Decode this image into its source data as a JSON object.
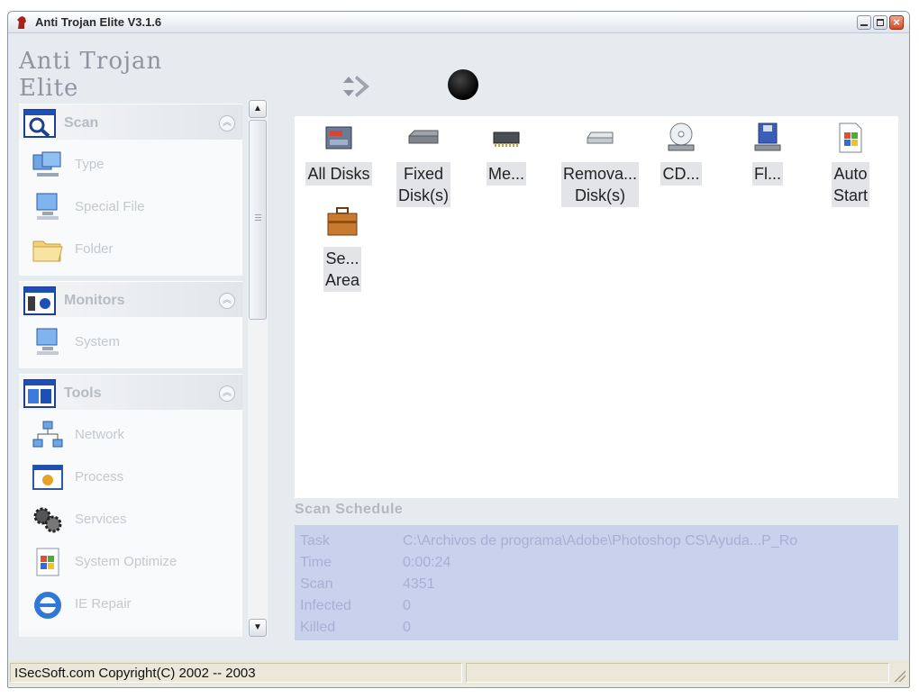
{
  "window": {
    "title": "Anti Trojan Elite V3.1.6"
  },
  "header": {
    "logo_text": "Anti Trojan Elite"
  },
  "sidebar": {
    "sections": [
      {
        "title": "Scan",
        "icon": "scan-icon",
        "items": [
          {
            "label": "Type",
            "icon": "computers-icon"
          },
          {
            "label": "Special File",
            "icon": "computer-icon"
          },
          {
            "label": "Folder",
            "icon": "folder-icon"
          }
        ]
      },
      {
        "title": "Monitors",
        "icon": "monitors-icon",
        "items": [
          {
            "label": "System",
            "icon": "computer-icon"
          }
        ]
      },
      {
        "title": "Tools",
        "icon": "tools-icon",
        "items": [
          {
            "label": "Network",
            "icon": "network-icon"
          },
          {
            "label": "Process",
            "icon": "process-icon"
          },
          {
            "label": "Services",
            "icon": "services-icon"
          },
          {
            "label": "System Optimize",
            "icon": "optimize-icon"
          },
          {
            "label": "IE Repair",
            "icon": "ie-icon"
          }
        ]
      }
    ]
  },
  "tiles": [
    {
      "label": "All Disks",
      "icon": "all-disks-icon"
    },
    {
      "label": "Fixed Disk(s)",
      "label_line1": "Fixed",
      "label_line2": "Disk(s)",
      "icon": "fixed-disk-icon"
    },
    {
      "label": "Me...",
      "icon": "memory-icon"
    },
    {
      "label": "Remova... Disk(s)",
      "label_line1": "Remova...",
      "label_line2": "Disk(s)",
      "icon": "removable-disk-icon"
    },
    {
      "label": "CD...",
      "icon": "cd-icon"
    },
    {
      "label": "Fl...",
      "icon": "floppy-icon"
    },
    {
      "label": "Auto Start",
      "label_line1": "Auto",
      "label_line2": "Start",
      "icon": "auto-start-icon"
    },
    {
      "label": "Se... Area",
      "label_line1": "Se...",
      "label_line2": "Area",
      "icon": "sensitive-area-icon"
    }
  ],
  "schedule": {
    "title": "Scan Schedule",
    "rows": [
      {
        "key": "Task",
        "value": "C:\\Archivos de programa\\Adobe\\Photoshop CS\\Ayuda...P_Ro"
      },
      {
        "key": "Time",
        "value": "0:00:24"
      },
      {
        "key": "Scan",
        "value": "4351"
      },
      {
        "key": "Infected",
        "value": "0"
      },
      {
        "key": "Killed",
        "value": "0"
      }
    ]
  },
  "statusbar": {
    "left": "ISecSoft.com  Copyright(C) 2002 -- 2003",
    "right": ""
  },
  "colors": {
    "schedule_bg": "#c9d1ed",
    "content_bg": "#ffffff",
    "window_bg": "#e6ebf0"
  }
}
